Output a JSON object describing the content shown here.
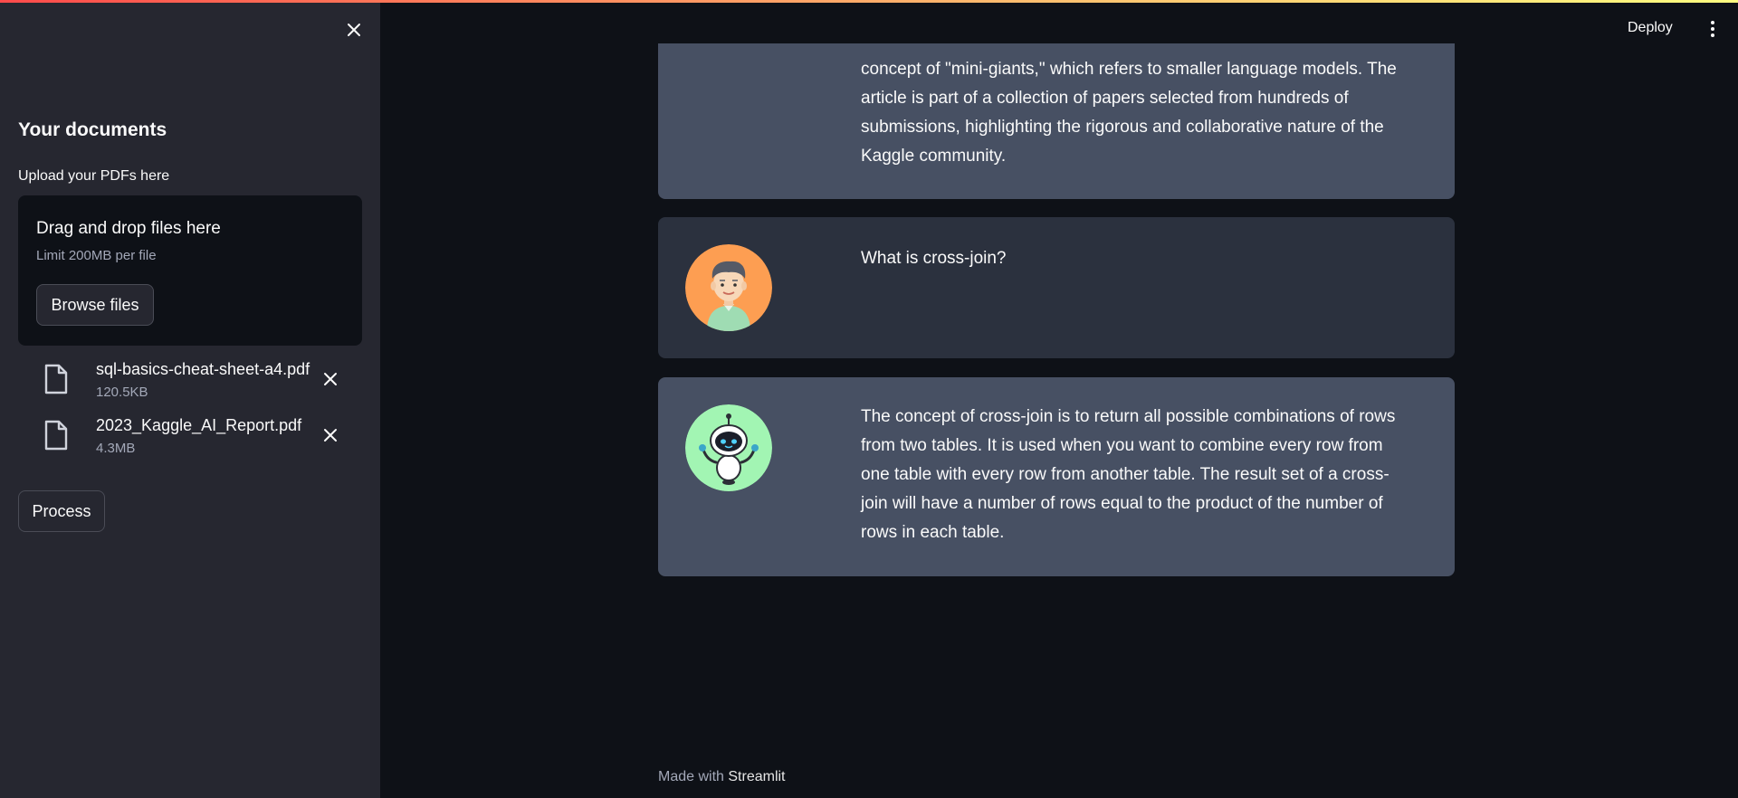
{
  "sidebar": {
    "title": "Your documents",
    "upload_label": "Upload your PDFs here",
    "dropzone": {
      "main_text": "Drag and drop files here",
      "limit_text": "Limit 200MB per file",
      "browse_label": "Browse files"
    },
    "files": [
      {
        "name": "sql-basics-cheat-sheet-a4.pdf",
        "size": "120.5KB"
      },
      {
        "name": "2023_Kaggle_AI_Report.pdf",
        "size": "4.3MB"
      }
    ],
    "process_label": "Process"
  },
  "header": {
    "deploy_label": "Deploy",
    "menu_icon": "more-vertical-icon"
  },
  "chat": {
    "messages": [
      {
        "role": "bot",
        "text": "concept of \"mini-giants,\" which refers to smaller language models. The article is part of a collection of papers selected from hundreds of submissions, highlighting the rigorous and collaborative nature of the Kaggle community."
      },
      {
        "role": "user",
        "text": "What is cross-join?"
      },
      {
        "role": "bot",
        "text": "The concept of cross-join is to return all possible combinations of rows from two tables. It is used when you want to combine every row from one table with every row from another table. The result set of a cross-join will have a number of rows equal to the product of the number of rows in each table."
      }
    ]
  },
  "footer": {
    "prefix": "Made with",
    "brand": "Streamlit"
  },
  "colors": {
    "app_bg": "#0e1117",
    "sidebar_bg": "#262730",
    "bot_message_bg": "#475063",
    "user_message_bg": "#2b313e",
    "user_avatar_bg": "#fd9e52",
    "bot_avatar_bg": "#a2f5b3"
  }
}
